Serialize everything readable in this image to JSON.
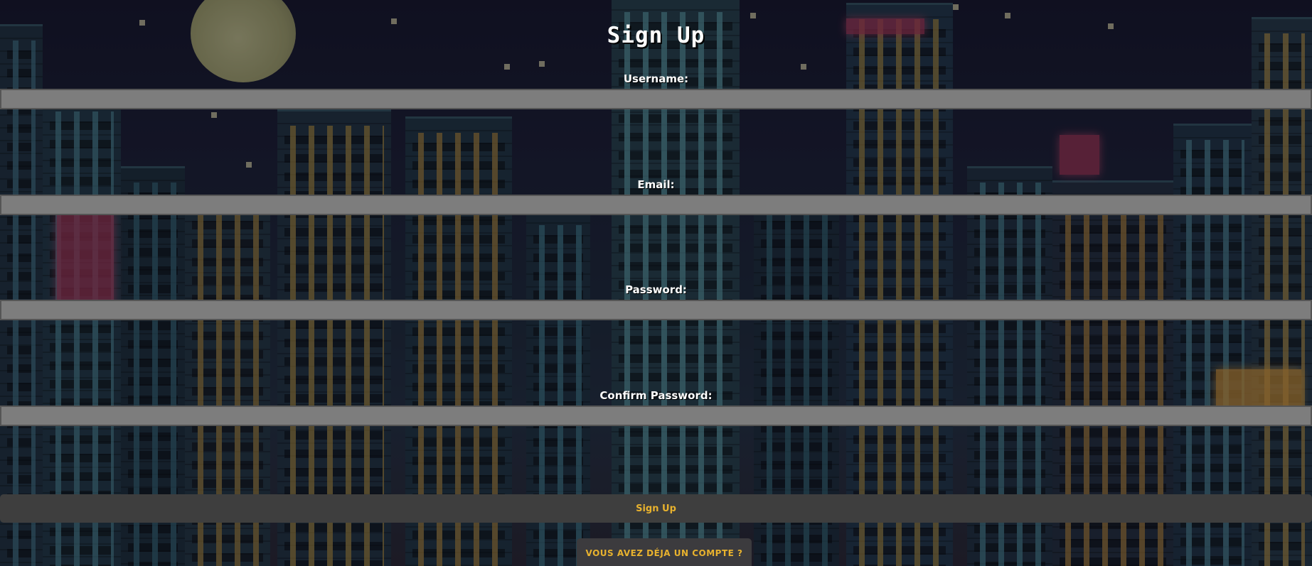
{
  "form": {
    "title": "Sign Up",
    "fields": [
      {
        "label": "Username:",
        "value": "",
        "type": "text"
      },
      {
        "label": "Email:",
        "value": "",
        "type": "email"
      },
      {
        "label": "Password:",
        "value": "",
        "type": "password"
      },
      {
        "label": "Confirm Password:",
        "value": "",
        "type": "password"
      }
    ],
    "submit_label": "Sign Up",
    "login_link_label": "VOUS AVEZ DÉJA UN COMPTE ?"
  },
  "colors": {
    "field_background": "#7d7d7d",
    "button_background": "#3e3e3e",
    "button_text": "#e8b22e",
    "label_text": "#ffffff"
  },
  "background": {
    "description_icon": "pixel-city-night-icon"
  }
}
